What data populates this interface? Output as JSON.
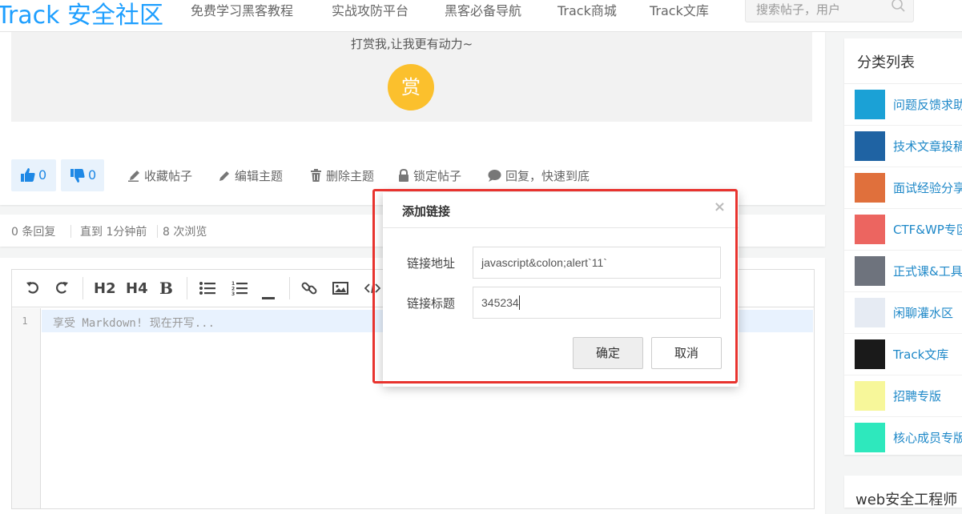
{
  "nav": {
    "logo": "Track 安全社区",
    "links": [
      "免费学习黑客教程",
      "实战攻防平台",
      "黑客必备导航",
      "Track商城",
      "Track文库"
    ],
    "search_placeholder": "搜索帖子，用户"
  },
  "reward": {
    "text": "打赏我,让我更有动力~",
    "button": "赏"
  },
  "actions": {
    "like_count": "0",
    "dislike_count": "0",
    "favorite": "收藏帖子",
    "edit": "编辑主题",
    "delete": "删除主题",
    "lock": "锁定帖子",
    "reply": "回复，快速到底"
  },
  "stats": {
    "replies": "0 条回复",
    "time": "直到 1分钟前",
    "views": "8 次浏览"
  },
  "editor": {
    "toolbar": {
      "h2": "H2",
      "h4": "H4",
      "bold": "B"
    },
    "line_number": "1",
    "placeholder": "享受 Markdown! 现在开写..."
  },
  "sidebar": {
    "title": "分类列表",
    "categories": [
      {
        "label": "问题反馈求助",
        "color": "#1ba1d6"
      },
      {
        "label": "技术文章投稿",
        "color": "#1f63a3"
      },
      {
        "label": "面试经验分享",
        "color": "#e0703c"
      },
      {
        "label": "CTF&WP专区",
        "color": "#ec6560"
      },
      {
        "label": "正式课&工具",
        "color": "#6e737d"
      },
      {
        "label": "闲聊灌水区",
        "color": "#e6ebf3"
      },
      {
        "label": "Track文库",
        "color": "#1a1a1a"
      },
      {
        "label": "招聘专版",
        "color": "#f7f79a"
      },
      {
        "label": "核心成员专版",
        "color": "#2ee8bd"
      }
    ],
    "next_card_title": "web安全工程师"
  },
  "modal": {
    "title": "添加链接",
    "close": "×",
    "url_label": "链接地址",
    "url_value": "javascript&colon;alert`11`",
    "title_label": "链接标题",
    "title_value": "345234",
    "ok": "确定",
    "cancel": "取消"
  }
}
